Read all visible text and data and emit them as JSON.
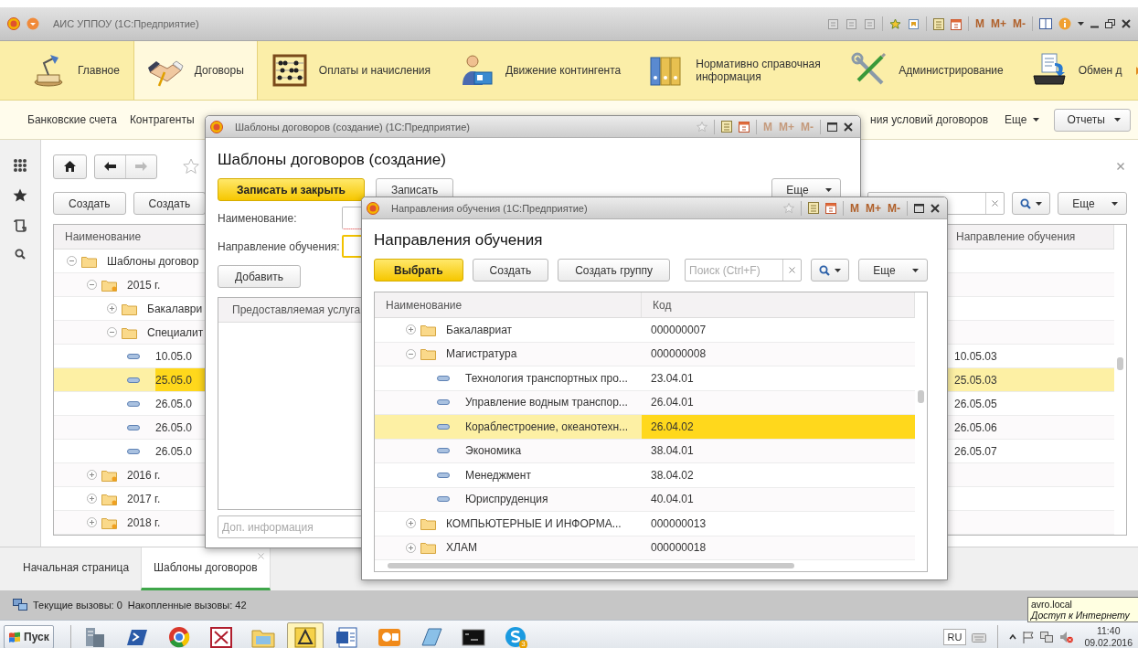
{
  "window": {
    "title": "АИС УППОУ  (1С:Предприятие)",
    "memory_buttons": [
      {
        "label": "M",
        "disabled": false
      },
      {
        "label": "M+",
        "disabled": false
      },
      {
        "label": "M-",
        "disabled": false
      }
    ]
  },
  "sections": [
    {
      "label": "Главное",
      "selected": false
    },
    {
      "label": "Договоры",
      "selected": true
    },
    {
      "label": "Оплаты и начисления",
      "selected": false
    },
    {
      "label": "Движение контингента",
      "selected": false
    },
    {
      "label": "Нормативно справочная информация",
      "selected": false
    },
    {
      "label": "Администрирование",
      "selected": false
    },
    {
      "label": "Обмен д",
      "selected": false
    }
  ],
  "submenu": {
    "links": [
      "Банковские счета",
      "Контрагенты",
      "ния условий договоров"
    ],
    "more": "Еще",
    "reports": "Отчеты"
  },
  "list_form": {
    "buttons": [
      "Создать",
      "Создать"
    ],
    "more": "Еще",
    "columns": [
      {
        "label": "Наименование",
        "current": true
      },
      {
        "label": "Направление обучения",
        "current": false
      }
    ],
    "rows": [
      {
        "kind": "folder",
        "name": "Шаблоны договор",
        "expanded": true,
        "selected": false,
        "children": [
          {
            "kind": "year",
            "name": "2015 г.",
            "expanded": true,
            "selected": false,
            "children": [
              {
                "kind": "folder",
                "name": "Бакалаври",
                "expanded": false,
                "selected": false
              },
              {
                "kind": "folder",
                "name": "Специалит",
                "expanded": true,
                "selected": false,
                "children": [
                  {
                    "kind": "item",
                    "name": "10.05.0",
                    "direction": "10.05.03",
                    "selected": false
                  },
                  {
                    "kind": "item",
                    "name": "25.05.0",
                    "direction": "25.05.03",
                    "selected": true
                  },
                  {
                    "kind": "item",
                    "name": "26.05.0",
                    "direction": "26.05.05",
                    "selected": false
                  },
                  {
                    "kind": "item",
                    "name": "26.05.0",
                    "direction": "26.05.06",
                    "selected": false
                  },
                  {
                    "kind": "item",
                    "name": "26.05.0",
                    "direction": "26.05.07",
                    "selected": false
                  }
                ]
              }
            ]
          },
          {
            "kind": "year",
            "name": "2016 г.",
            "expanded": false,
            "selected": false
          },
          {
            "kind": "year",
            "name": "2017 г.",
            "expanded": false,
            "selected": false
          },
          {
            "kind": "year",
            "name": "2018 г.",
            "expanded": false,
            "selected": false
          }
        ]
      }
    ]
  },
  "tabs": [
    {
      "label": "Начальная страница",
      "selected": false
    },
    {
      "label": "Шаблоны договоров",
      "selected": true
    }
  ],
  "status_bar": [
    "Текущие вызовы: 0",
    "Накопленные вызовы: 42"
  ],
  "taskbar": {
    "start": "Пуск",
    "apps": [
      {
        "selected": false
      },
      {
        "selected": false
      },
      {
        "selected": false
      },
      {
        "selected": false
      },
      {
        "selected": false
      },
      {
        "selected": true
      },
      {
        "selected": false
      },
      {
        "selected": false
      },
      {
        "selected": false
      },
      {
        "selected": false
      },
      {
        "selected": false,
        "badge": "3"
      }
    ],
    "language": "RU",
    "time": "11:40",
    "date": "09.02.2016"
  },
  "tooltip": {
    "title": "avro.local",
    "text": "Доступ к Интернету"
  },
  "template_dialog": {
    "window_title": "Шаблоны договоров (создание)  (1С:Предприятие)",
    "memory_buttons": [
      {
        "label": "M",
        "disabled": true
      },
      {
        "label": "M+",
        "disabled": true
      },
      {
        "label": "M-",
        "disabled": true
      }
    ],
    "heading": "Шаблоны договоров (создание)",
    "buttons": [
      {
        "label": "Записать и закрыть",
        "default": true
      },
      {
        "label": "Записать",
        "default": false
      }
    ],
    "more": "Еще",
    "fields": [
      {
        "label": "Наименование:",
        "required": true,
        "focused": false
      },
      {
        "label": "Направление обучения:",
        "required": false,
        "focused": true
      }
    ],
    "add_button": "Добавить",
    "table": {
      "columns": [
        "Предоставляемая услуга"
      ]
    },
    "info_field": {
      "placeholder": "Доп. информация"
    }
  },
  "directions_dialog": {
    "window_title": "Направления обучения  (1С:Предприятие)",
    "memory_buttons": [
      {
        "label": "M",
        "disabled": false
      },
      {
        "label": "M+",
        "disabled": false
      },
      {
        "label": "M-",
        "disabled": false
      }
    ],
    "heading": "Направления обучения",
    "buttons": [
      {
        "label": "Выбрать",
        "default": true
      },
      {
        "label": "Создать",
        "default": false
      },
      {
        "label": "Создать группу",
        "default": false
      }
    ],
    "search": {
      "placeholder": "Поиск (Ctrl+F)"
    },
    "more": "Еще",
    "columns": [
      {
        "label": "Наименование",
        "current": false
      },
      {
        "label": "Код",
        "current": true
      }
    ],
    "rows": [
      {
        "kind": "folder",
        "name": "Бакалавриат",
        "code": "000000007",
        "expanded": false,
        "selected": false
      },
      {
        "kind": "folder",
        "name": "Магистратура",
        "code": "000000008",
        "expanded": true,
        "selected": false,
        "children": [
          {
            "kind": "item",
            "name": "Технология транспортных про...",
            "code": "23.04.01",
            "selected": false
          },
          {
            "kind": "item",
            "name": "Управление водным транспор...",
            "code": "26.04.01",
            "selected": false
          },
          {
            "kind": "item",
            "name": "Кораблестроение, океанотехн...",
            "code": "26.04.02",
            "selected": true
          },
          {
            "kind": "item",
            "name": "Экономика",
            "code": "38.04.01",
            "selected": false
          },
          {
            "kind": "item",
            "name": "Менеджмент",
            "code": "38.04.02",
            "selected": false
          },
          {
            "kind": "item",
            "name": "Юриспруденция",
            "code": "40.04.01",
            "selected": false
          }
        ]
      },
      {
        "kind": "folder",
        "name": "КОМПЬЮТЕРНЫЕ И ИНФОРМА...",
        "code": "000000013",
        "expanded": false,
        "selected": false
      },
      {
        "kind": "folder",
        "name": "ХЛАМ",
        "code": "000000018",
        "expanded": false,
        "selected": false
      }
    ]
  }
}
